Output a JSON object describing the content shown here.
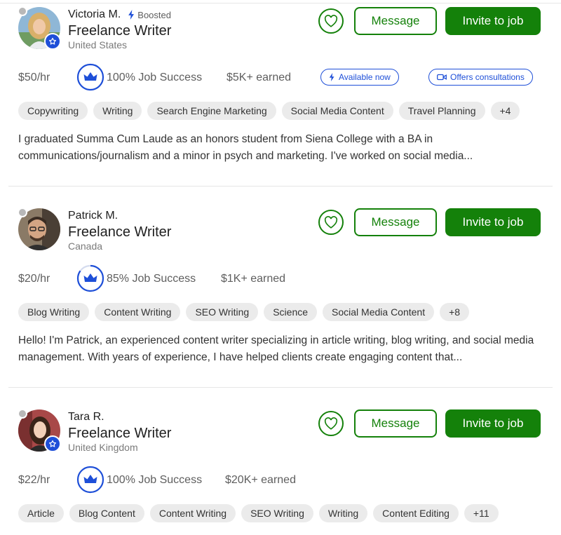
{
  "colors": {
    "accent_green": "#14810a",
    "badge_blue": "#1e4fd8",
    "chip_bg": "#ebebeb"
  },
  "icons": {
    "heart": "heart-icon",
    "bolt": "lightning-bolt-icon",
    "crown": "crown-icon",
    "video": "video-camera-icon",
    "star": "star-icon"
  },
  "freelancers": [
    {
      "name": "Victoria M.",
      "boosted_label": "Boosted",
      "title": "Freelance Writer",
      "location": "United States",
      "message_label": "Message",
      "invite_label": "Invite to job",
      "rate": "$50/hr",
      "job_success": "100% Job Success",
      "job_success_percent": 100,
      "earned": "$5K+ earned",
      "available_label": "Available now",
      "consult_label": "Offers consultations",
      "skills": [
        "Copywriting",
        "Writing",
        "Search Engine Marketing",
        "Social Media Content",
        "Travel Planning",
        "+4"
      ],
      "description": "I graduated Summa Cum Laude as an honors student from Siena College with a BA in communications/journalism and a minor in psych and marketing. I've worked on social media..."
    },
    {
      "name": "Patrick M.",
      "title": "Freelance Writer",
      "location": "Canada",
      "message_label": "Message",
      "invite_label": "Invite to job",
      "rate": "$20/hr",
      "job_success": "85% Job Success",
      "job_success_percent": 85,
      "earned": "$1K+ earned",
      "skills": [
        "Blog Writing",
        "Content Writing",
        "SEO Writing",
        "Science",
        "Social Media Content",
        "+8"
      ],
      "description": "Hello! I'm Patrick, an experienced content writer specializing in article writing, blog writing, and social media management. With years of experience, I have helped clients create engaging content that..."
    },
    {
      "name": "Tara R.",
      "title": "Freelance Writer",
      "location": "United Kingdom",
      "message_label": "Message",
      "invite_label": "Invite to job",
      "rate": "$22/hr",
      "job_success": "100% Job Success",
      "job_success_percent": 100,
      "earned": "$20K+ earned",
      "skills": [
        "Article",
        "Blog Content",
        "Content Writing",
        "SEO Writing",
        "Writing",
        "Content Editing",
        "+11"
      ],
      "description": ""
    }
  ]
}
